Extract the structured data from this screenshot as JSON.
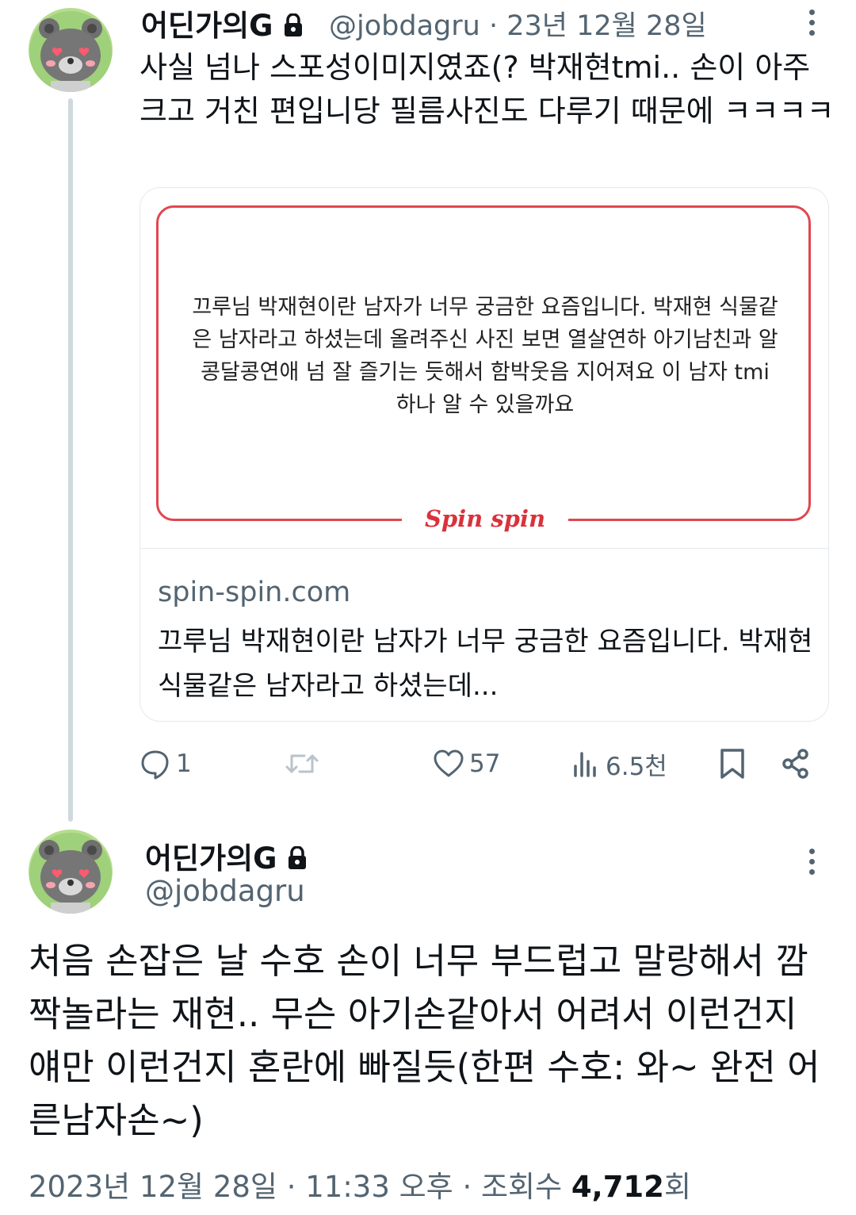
{
  "tweet1": {
    "display_name": "어딘가의G",
    "handle": "@jobdagru",
    "separator": "·",
    "date": "23년 12월 28일",
    "text": "사실 넘나 스포성이미지였죠(? 박재현tmi.. 손이 아주 크고 거친 편입니당 필름사진도 다루기 때문에 ㅋㅋㅋㅋ",
    "card": {
      "image_question": "끄루님 박재현이란 남자가 너무 궁금한 요즘입니다. 박재현 식물같은 남자라고 하셨는데 올려주신 사진 보면 열살연하 아기남친과 알콩달콩연애 넘 잘 즐기는 듯해서 함박웃음 지어져요 이 남자 tmi 하나 알 수 있을까요",
      "brand": "Spin spin",
      "domain": "spin-spin.com",
      "title": "끄루님 박재현이란 남자가 너무 궁금한 요즘입니다. 박재현 식물같은 남자라고 하셨는데..."
    },
    "actions": {
      "reply_count": "1",
      "like_count": "57",
      "view_count": "6.5천"
    }
  },
  "tweet2": {
    "display_name": "어딘가의G",
    "handle": "@jobdagru",
    "text": "처음 손잡은 날 수호 손이 너무 부드럽고 말랑해서 깜짝놀라는 재현.. 무슨 아기손같아서 어려서 이런건지 얘만 이런건지 혼란에 빠질듯(한편 수호: 와~ 완전 어른남자손~)",
    "timestamp": "2023년 12월 28일 · 11:33 오후 · 조회수",
    "views": "4,712",
    "views_suffix": "회"
  },
  "colors": {
    "text_primary": "#0f1419",
    "text_secondary": "#536471",
    "thread_line": "#cfd9de",
    "card_border": "#e4e9ec",
    "brand_red": "#e0474f"
  }
}
